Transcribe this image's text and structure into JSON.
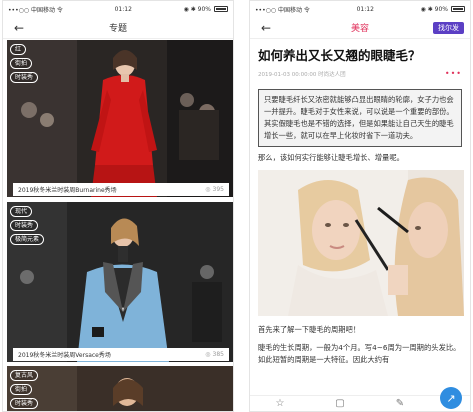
{
  "left": {
    "status": {
      "carrier": "•••○○ 中国移动 令",
      "time": "01:12",
      "battery": "◉ ✱ 90%"
    },
    "nav": {
      "title": "专题"
    },
    "cards": [
      {
        "tags": [
          "红",
          "街拍",
          "时装秀"
        ],
        "caption": "2019秋冬米兰时装周Burnarine秀场",
        "views": "395"
      },
      {
        "tags": [
          "现代",
          "时装秀",
          "极简元素"
        ],
        "caption": "2019秋冬米兰时装周Versace秀场",
        "views": "385"
      },
      {
        "tags": [
          "复古风",
          "街拍",
          "时装秀"
        ]
      }
    ]
  },
  "right": {
    "status": {
      "carrier": "•••○○ 中国移动 令",
      "time": "01:12",
      "battery": "◉ ✱ 90%"
    },
    "nav": {
      "title": "美容",
      "action": "找尔发"
    },
    "title": "如何养出又长又翘的眼睫毛？",
    "meta": "2019-01-03 00:00:00   时尚达人团",
    "quote": "只要睫毛纤长又浓密就能够凸显出眼睛的轮廓，女子力也会一并提升。睫毛对于女性来说，可以说是一个重要的部份。其实假睫毛也是不错的选择，但是如果能让自己天生的睫毛增长一些，就可以在早上化妆时省下一道功夫。",
    "para1": "那么，该如何实行能够让睫毛增长、增量呢。",
    "para2": "首先来了解一下睫毛的周期吧！",
    "para3": "睫毛的生长周期，一般为4个月。写4~6周为一周期的头发比。如此短暂的周期是一大特征。因此大约有",
    "icons": [
      "star-icon",
      "comment-icon",
      "edit-icon",
      "share-icon"
    ]
  }
}
